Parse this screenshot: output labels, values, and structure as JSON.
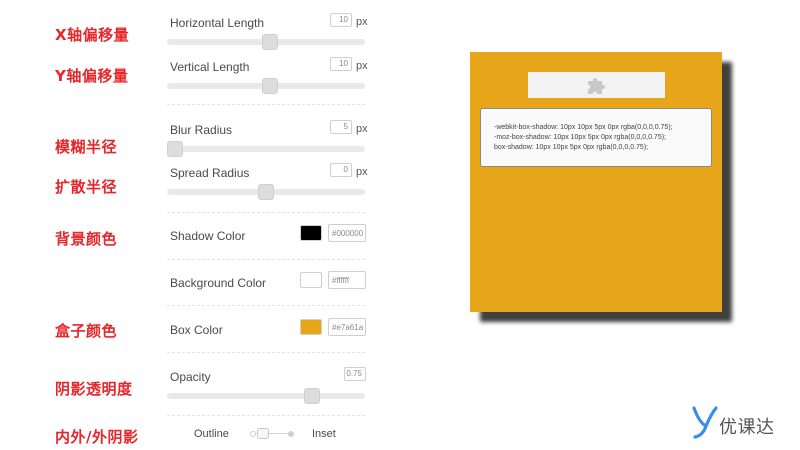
{
  "annotations": {
    "x_offset": "X轴偏移量",
    "y_offset": "Y轴偏移量",
    "blur": "模糊半径",
    "spread": "扩散半径",
    "bg_color": "背景颜色",
    "box_color": "盒子颜色",
    "opacity": "阴影透明度",
    "inset": "内外/外阴影"
  },
  "controls": {
    "horizontal": {
      "label": "Horizontal Length",
      "value": "10",
      "unit": "px",
      "level": 0.52
    },
    "vertical": {
      "label": "Vertical Length",
      "value": "10",
      "unit": "px",
      "level": 0.52
    },
    "blur": {
      "label": "Blur Radius",
      "value": "5",
      "unit": "px",
      "level": 0.0
    },
    "spread": {
      "label": "Spread Radius",
      "value": "0",
      "unit": "px",
      "level": 0.5
    },
    "shadow_color": {
      "label": "Shadow Color",
      "hex": "#000000",
      "color": "#000000"
    },
    "background_color": {
      "label": "Background Color",
      "hex": "#ffffff",
      "color": "#ffffff"
    },
    "box_color": {
      "label": "Box Color",
      "hex": "#e7a61a",
      "color": "#e7a61a"
    },
    "opacity": {
      "label": "Opacity",
      "value": "0.75",
      "level": 0.75
    },
    "toggle": {
      "left_label": "Outline",
      "right_label": "Inset",
      "state": "outline"
    }
  },
  "preview": {
    "icon": "puzzle-icon",
    "code_lines": [
      "-webkit-box-shadow: 10px 10px 5px 0px rgba(0,0,0,0.75);",
      "-moz-box-shadow: 10px 10px 5px 0px rgba(0,0,0,0.75);",
      "box-shadow: 10px 10px 5px 0px rgba(0,0,0,0.75);"
    ]
  },
  "brand": {
    "name": "优课达",
    "icon": "youkeda-logo-icon",
    "color": "#3a8ee6"
  }
}
